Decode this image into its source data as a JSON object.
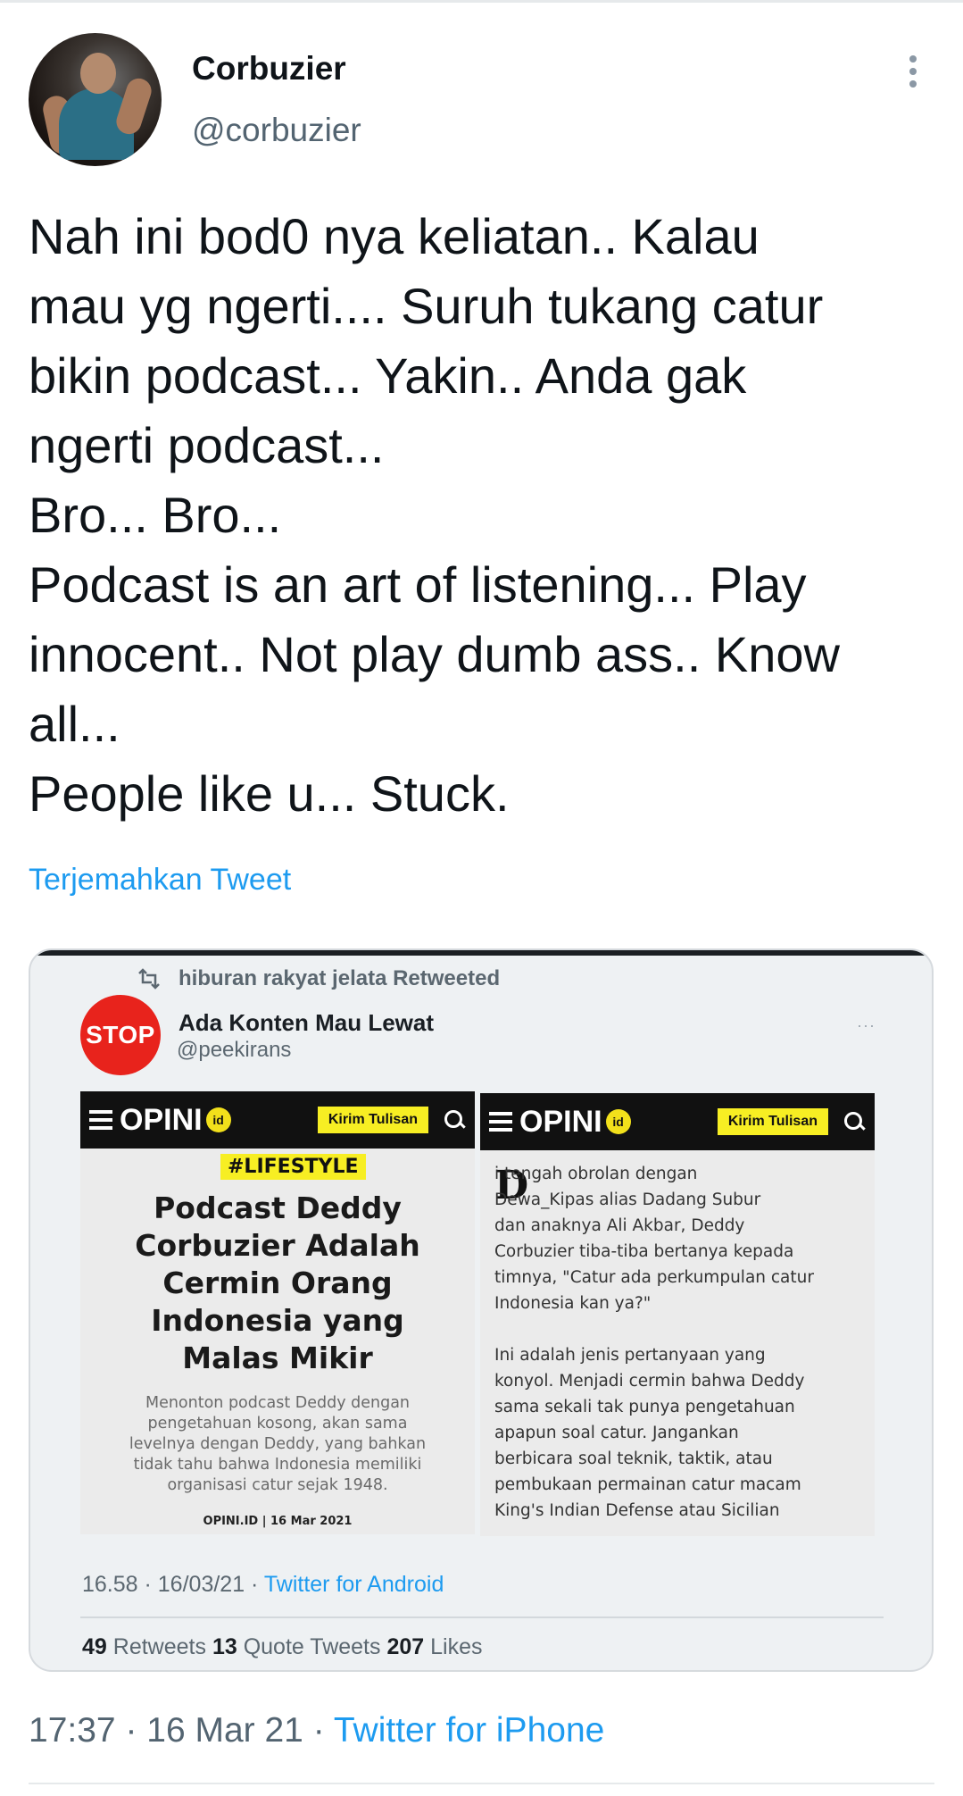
{
  "tweet": {
    "author_name": "Corbuzier",
    "author_handle": "@corbuzier",
    "text": "Nah ini bod0 nya keliatan.. Kalau\nmau yg ngerti.... Suruh tukang catur\nbikin podcast... Yakin.. Anda gak\nngerti podcast...\nBro... Bro...\nPodcast is an art of listening... Play\ninnocent.. Not play dumb ass.. Know\nall...\nPeople like u... Stuck.",
    "translate_label": "Terjemahkan Tweet",
    "time": "17:37",
    "date": "16 Mar 21",
    "source": "Twitter for iPhone",
    "separator": " · "
  },
  "embedded": {
    "retweeted_by": "hiburan rakyat jelata Retweeted",
    "avatar_text": "STOP",
    "author_name": "Ada Konten Mau Lewat",
    "author_handle": "@peekirans",
    "more": "···",
    "left_article": {
      "logo": "OPINI",
      "logo_badge": "id",
      "submit_label": "Kirim Tulisan",
      "tag": "#LIFESTYLE",
      "headline": "Podcast Deddy\nCorbuzier Adalah\nCermin Orang\nIndonesia yang\nMalas Mikir",
      "lede": "Menonton podcast Deddy dengan\npengetahuan kosong, akan sama\nlevelnya dengan Deddy, yang bahkan\ntidak tahu bahwa Indonesia memiliki\norganisasi catur sejak 1948.",
      "byline": "OPINI.ID  |  16 Mar 2021"
    },
    "right_article": {
      "logo": "OPINI",
      "logo_badge": "id",
      "submit_label": "Kirim Tulisan",
      "dropcap": "D",
      "body": "      i tengah obrolan dengan\n      Dewa_Kipas alias Dadang Subur\ndan anaknya Ali Akbar, Deddy\nCorbuzier tiba-tiba bertanya kepada\ntimnya, \"Catur ada perkumpulan catur\nIndonesia kan ya?\"\n\nIni adalah jenis pertanyaan yang\nkonyol. Menjadi cermin bahwa Deddy\nsama sekali tak punya pengetahuan\napapun soal catur. Jangankan\nberbicara soal teknik, taktik, atau\npembukaan permainan catur macam\nKing's Indian Defense atau Sicilian"
    },
    "time": "16.58",
    "date": "16/03/21",
    "source": "Twitter for Android",
    "separator": " · ",
    "retweets_count": "49",
    "retweets_label": "Retweets",
    "quotes_count": "13",
    "quotes_label": "Quote Tweets",
    "likes_count": "207",
    "likes_label": "Likes"
  },
  "colors": {
    "link": "#1d9bf0",
    "secondary_text": "#536471",
    "stop_red": "#e8231c",
    "opini_yellow": "#f7ee23"
  }
}
